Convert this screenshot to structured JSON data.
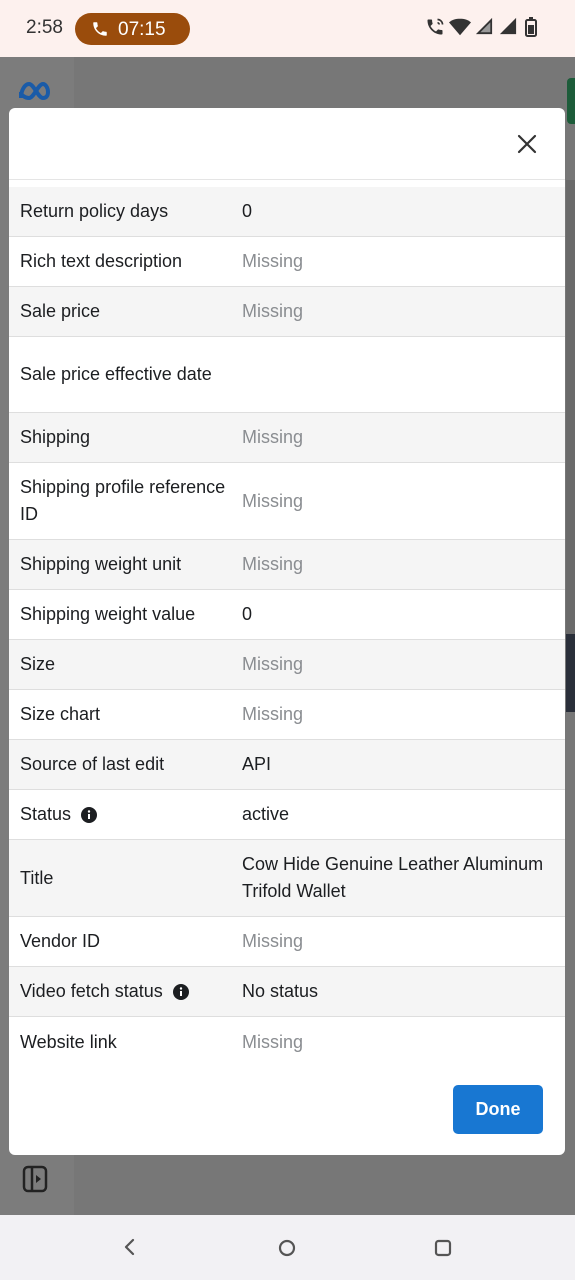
{
  "status_bar": {
    "time": "2:58",
    "call_timer": "07:15"
  },
  "modal": {
    "rows": [
      {
        "label": "Return policy days",
        "value": "0",
        "missing": false,
        "info": false
      },
      {
        "label": "Rich text description",
        "value": "Missing",
        "missing": true,
        "info": false
      },
      {
        "label": "Sale price",
        "value": "Missing",
        "missing": true,
        "info": false
      },
      {
        "label": "Sale price effective date",
        "value": "",
        "missing": false,
        "info": false
      },
      {
        "label": "Shipping",
        "value": "Missing",
        "missing": true,
        "info": false
      },
      {
        "label": "Shipping profile reference ID",
        "value": "Missing",
        "missing": true,
        "info": false
      },
      {
        "label": "Shipping weight unit",
        "value": "Missing",
        "missing": true,
        "info": false
      },
      {
        "label": "Shipping weight value",
        "value": "0",
        "missing": false,
        "info": false
      },
      {
        "label": "Size",
        "value": "Missing",
        "missing": true,
        "info": false
      },
      {
        "label": "Size chart",
        "value": "Missing",
        "missing": true,
        "info": false
      },
      {
        "label": "Source of last edit",
        "value": "API",
        "missing": false,
        "info": false
      },
      {
        "label": "Status",
        "value": "active",
        "missing": false,
        "info": true
      },
      {
        "label": "Title",
        "value": "Cow Hide Genuine Leather Aluminum Trifold Wallet",
        "missing": false,
        "info": false
      },
      {
        "label": "Vendor ID",
        "value": "Missing",
        "missing": true,
        "info": false
      },
      {
        "label": "Video fetch status",
        "value": "No status",
        "missing": false,
        "info": true
      },
      {
        "label": "Website link",
        "value": "Missing",
        "missing": true,
        "info": false
      }
    ],
    "done_label": "Done"
  },
  "icons": {
    "close": "close-icon",
    "info": "info-icon",
    "meta_logo": "meta-logo",
    "back": "nav-back-icon",
    "home": "nav-home-icon",
    "recents": "nav-recents-icon"
  },
  "colors": {
    "primary_button": "#1877d2",
    "call_pill": "#9a4c0c",
    "missing_text": "#8a8d91"
  }
}
